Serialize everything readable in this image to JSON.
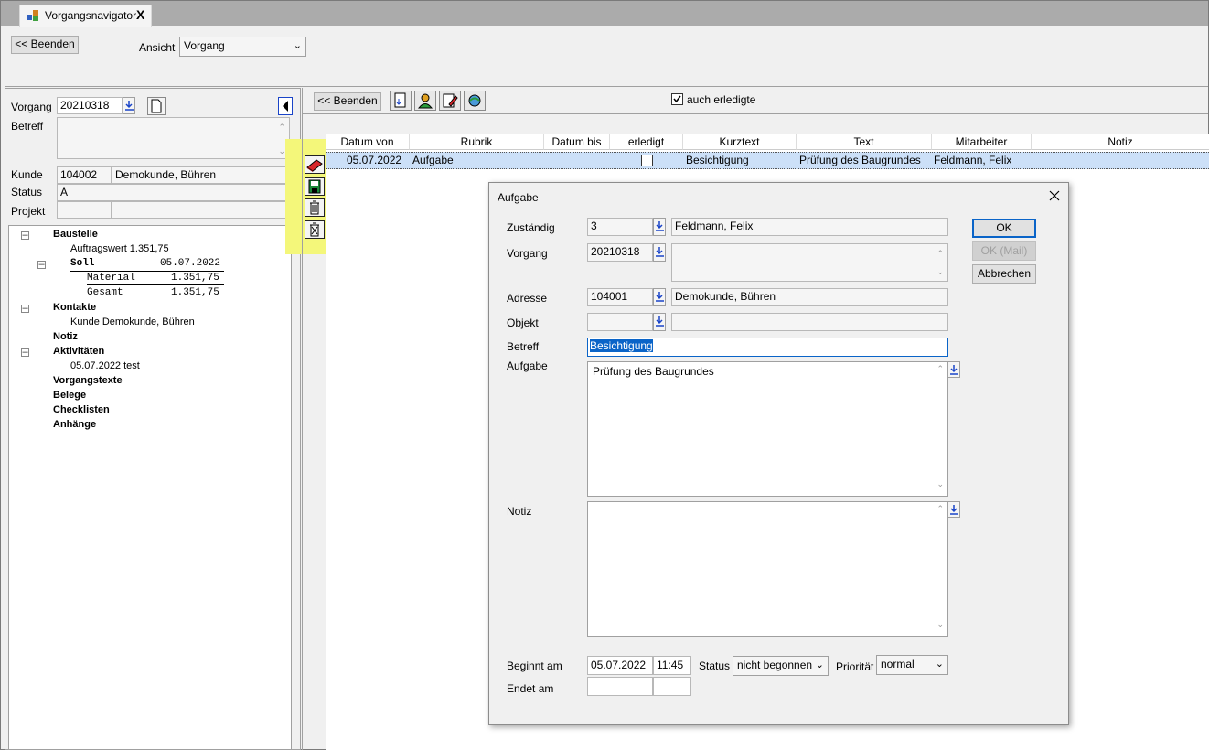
{
  "tab": {
    "label": "Vorgangsnavigator",
    "close": "X"
  },
  "top": {
    "end_button": "<< Beenden",
    "view_label": "Ansicht",
    "view_value": "Vorgang"
  },
  "left": {
    "vorgang_label": "Vorgang",
    "vorgang_value": "20210318",
    "betreff_label": "Betreff",
    "kunde_label": "Kunde",
    "kunde_id": "104002",
    "kunde_name": "Demokunde, Bühren",
    "status_label": "Status",
    "status_value": "A",
    "projekt_label": "Projekt"
  },
  "tree": {
    "baustelle": "Baustelle",
    "auftragswert": "Auftragswert  1.351,75",
    "soll": "Soll",
    "soll_date": "05.07.2022",
    "material": "Material",
    "material_value": "1.351,75",
    "gesamt": "Gesamt",
    "gesamt_value": "1.351,75",
    "kontakte": "Kontakte",
    "kunde": "Kunde  Demokunde, Bühren",
    "notiz": "Notiz",
    "aktivitaeten": "Aktivitäten",
    "aktivitaet_1": "05.07.2022  test",
    "vorgangstexte": "Vorgangstexte",
    "belege": "Belege",
    "checklisten": "Checklisten",
    "anhaenge": "Anhänge"
  },
  "right": {
    "end_button": "<< Beenden",
    "show_done_label": "auch erledigte",
    "show_done_checked": true
  },
  "grid": {
    "columns": [
      "Datum von",
      "Rubrik",
      "Datum bis",
      "erledigt",
      "Kurztext",
      "Text",
      "Mitarbeiter",
      "Notiz"
    ],
    "row": {
      "datum_von": "05.07.2022",
      "rubrik": "Aufgabe",
      "datum_bis": "",
      "erledigt": false,
      "kurztext": "Besichtigung",
      "text": "Prüfung des Baugrundes",
      "mitarbeiter": "Feldmann, Felix",
      "notiz": ""
    }
  },
  "dialog": {
    "title": "Aufgabe",
    "zustaendig_label": "Zuständig",
    "zustaendig_id": "3",
    "zustaendig_name": "Feldmann, Felix",
    "vorgang_label": "Vorgang",
    "vorgang_value": "20210318",
    "adresse_label": "Adresse",
    "adresse_id": "104001",
    "adresse_name": "Demokunde, Bühren",
    "objekt_label": "Objekt",
    "betreff_label": "Betreff",
    "betreff_value": "Besichtigung",
    "aufgabe_label": "Aufgabe",
    "aufgabe_value": "Prüfung des Baugrundes",
    "notiz_label": "Notiz",
    "beginnt_label": "Beginnt am",
    "beginnt_date": "05.07.2022",
    "beginnt_time": "11:45",
    "status_label": "Status",
    "status_value": "nicht begonnen",
    "prioritaet_label": "Priorität",
    "prioritaet_value": "normal",
    "endet_label": "Endet am",
    "ok_button": "OK",
    "ok_mail_button": "OK (Mail)",
    "cancel_button": "Abbrechen"
  },
  "colors": {
    "selection": "#cce0f8",
    "highlight": "#f4f77a",
    "dialog_accent": "#0a64c8"
  }
}
